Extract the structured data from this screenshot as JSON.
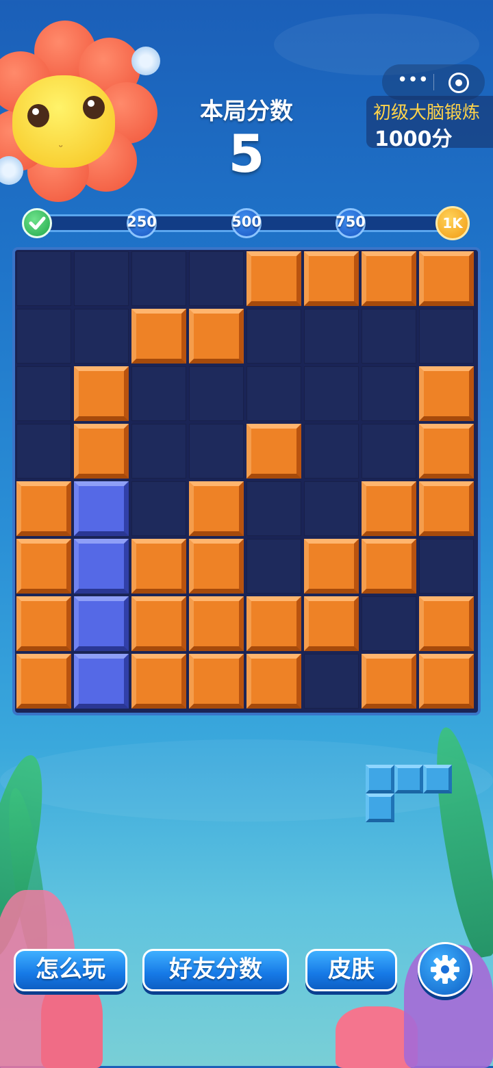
{
  "header": {
    "score_title": "本局分数",
    "score_value": "5",
    "level_name": "初级大脑锻炼",
    "level_target": "1000分",
    "capsule_more_icon": "more-dots-icon",
    "capsule_close_icon": "target-close-icon"
  },
  "progress": {
    "fraction": 0.01,
    "milestones": [
      "250",
      "500",
      "750"
    ],
    "goal_label": "1K"
  },
  "board": {
    "rows": [
      "....OOOO",
      "..OO....",
      ".O.....O",
      ".O..O..O",
      "OB.O..OO",
      "OBOO.OO.",
      "OBOOOO.O",
      "OBOOO.OO"
    ],
    "legend": {
      "O": "orange",
      "B": "blue",
      ".": "empty"
    },
    "colors": {
      "orange": "#ee8226",
      "blue": "#5569e6",
      "empty": "#1e2a5c"
    }
  },
  "next_piece": {
    "shape": [
      "XXX",
      "X.."
    ],
    "color": "#3fa6e6"
  },
  "buttons": {
    "how_to_play": "怎么玩",
    "friend_scores": "好友分数",
    "skins": "皮肤",
    "settings_icon": "gear-icon"
  }
}
